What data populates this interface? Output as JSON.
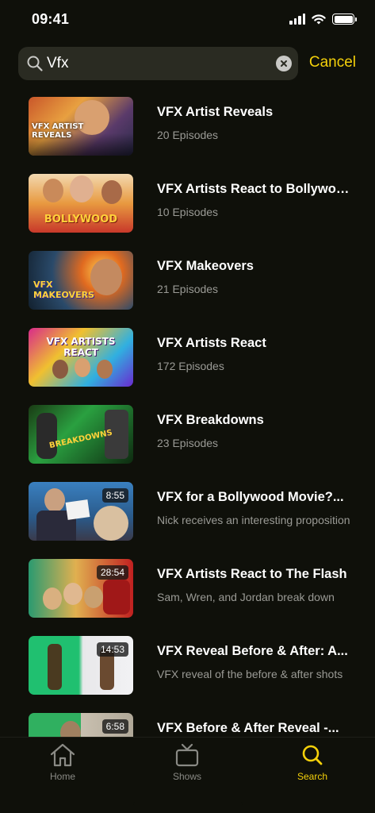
{
  "status_bar": {
    "time": "09:41"
  },
  "search": {
    "query": "Vfx",
    "cancel_label": "Cancel"
  },
  "results": [
    {
      "title": "VFX Artist Reveals",
      "subtitle": "20 Episodes",
      "duration": "",
      "thumb_text": "VFX ARTIST REVEALS"
    },
    {
      "title": "VFX Artists React to Bollywood",
      "subtitle": "10 Episodes",
      "duration": "",
      "thumb_text": "BOLLYWOOD"
    },
    {
      "title": "VFX Makeovers",
      "subtitle": "21 Episodes",
      "duration": "",
      "thumb_text": "VFX MAKEOVERS"
    },
    {
      "title": "VFX Artists React",
      "subtitle": "172 Episodes",
      "duration": "",
      "thumb_text": "VFX ARTISTS REACT"
    },
    {
      "title": "VFX Breakdowns",
      "subtitle": "23 Episodes",
      "duration": "",
      "thumb_text": "BREAKDOWNS"
    },
    {
      "title": "VFX for a Bollywood Movie?...",
      "subtitle": "Nick receives an interesting proposition",
      "duration": "8:55",
      "thumb_text": ""
    },
    {
      "title": "VFX Artists React to The Flash",
      "subtitle": "Sam, Wren, and Jordan break down",
      "duration": "28:54",
      "thumb_text": ""
    },
    {
      "title": "VFX Reveal Before & After: A...",
      "subtitle": "VFX reveal of the before & after shots",
      "duration": "14:53",
      "thumb_text": ""
    },
    {
      "title": "VFX Before & After Reveal -...",
      "subtitle": "",
      "duration": "6:58",
      "thumb_text": ""
    }
  ],
  "tabs": [
    {
      "label": "Home",
      "icon": "home-icon",
      "active": false
    },
    {
      "label": "Shows",
      "icon": "tv-icon",
      "active": false
    },
    {
      "label": "Search",
      "icon": "search-icon",
      "active": true
    }
  ],
  "colors": {
    "accent": "#f5d10a",
    "background": "#0f100a",
    "field": "#2a2b22",
    "muted": "#9a9a95"
  }
}
